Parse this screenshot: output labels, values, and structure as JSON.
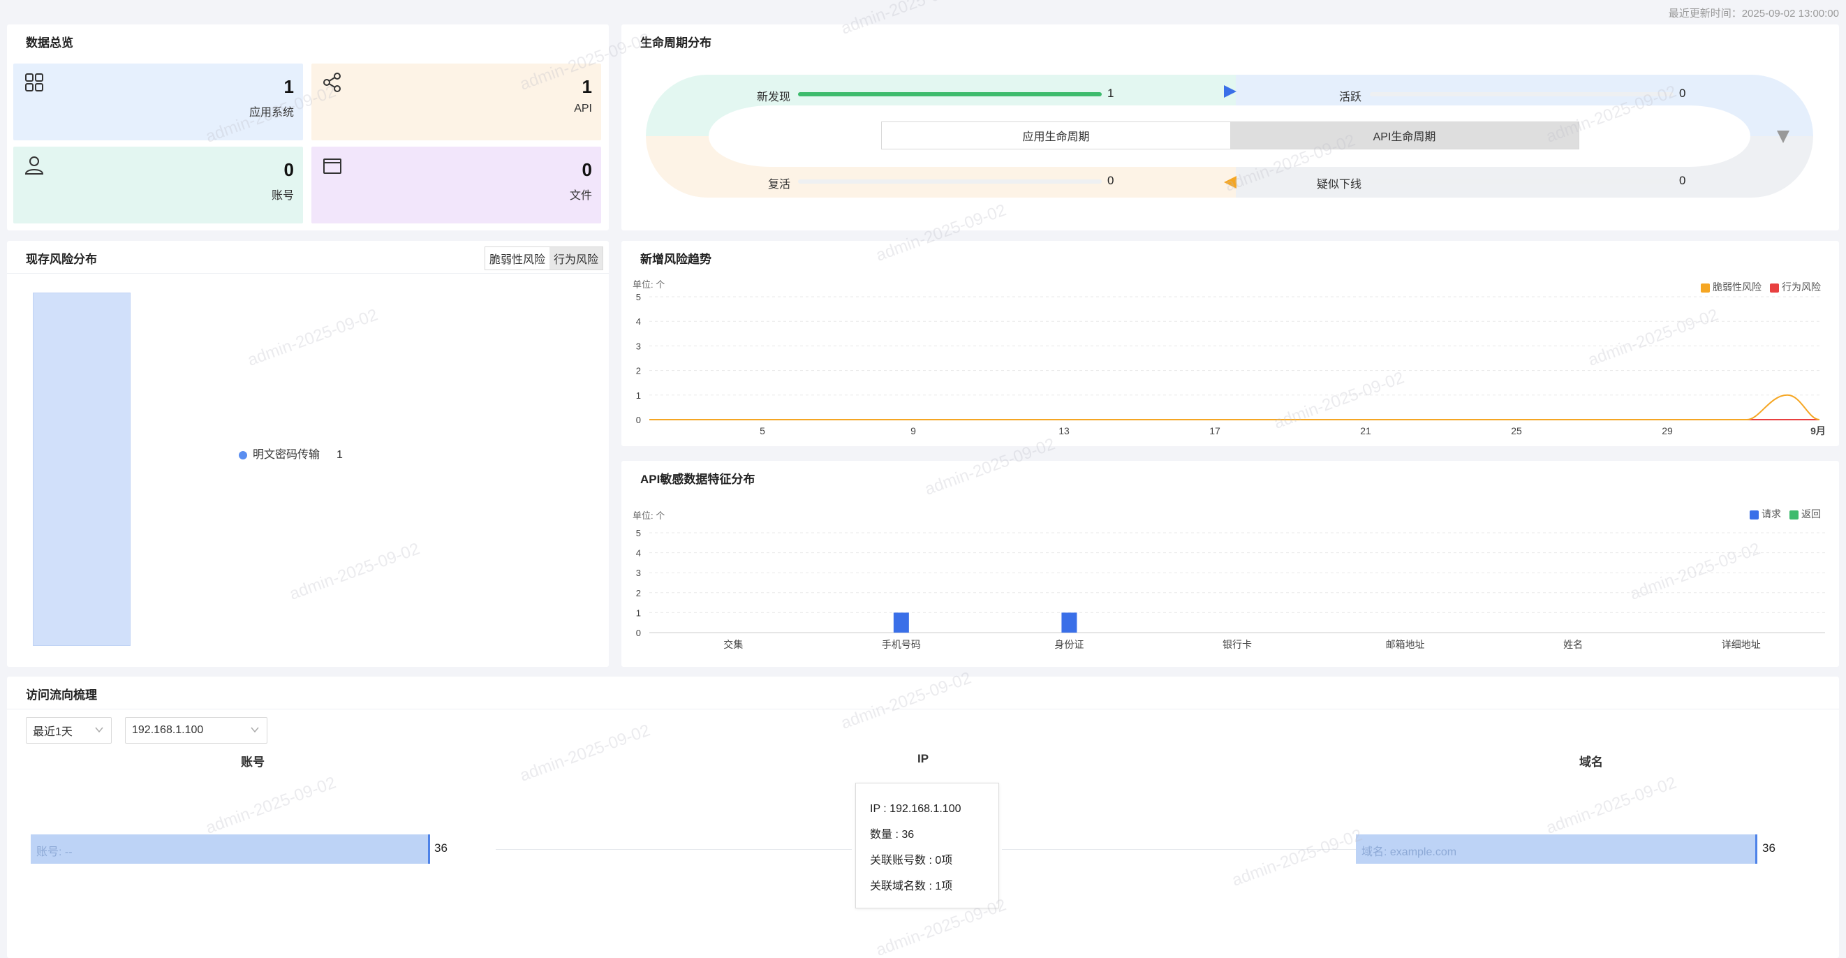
{
  "header": {
    "update_time": "最近更新时间：2025-09-02 13:00:00"
  },
  "overview": {
    "title": "数据总览",
    "cards": [
      {
        "icon": "grid-apps-icon",
        "count": "1",
        "label": "应用系统",
        "color": "#e6f0fd"
      },
      {
        "icon": "share-icon",
        "count": "1",
        "label": "API",
        "color": "#fdf3e6"
      },
      {
        "icon": "user-icon",
        "count": "0",
        "label": "账号",
        "color": "#e3f6f1"
      },
      {
        "icon": "folder-icon",
        "count": "0",
        "label": "文件",
        "color": "#f2e6fb"
      }
    ]
  },
  "lifecycle": {
    "title": "生命周期分布",
    "rows": [
      {
        "label": "新发现",
        "value": "1",
        "fill": 1.0
      },
      {
        "label": "活跃",
        "value": "0",
        "fill": 0
      },
      {
        "label": "复活",
        "value": "0",
        "fill": 0
      },
      {
        "label": "疑似下线",
        "value": "0",
        "fill": 0
      }
    ],
    "toggle": {
      "left": "应用生命周期",
      "right": "API生命周期",
      "active": "right"
    }
  },
  "risk": {
    "title": "现存风险分布",
    "tabs": [
      "脆弱性风险",
      "行为风险"
    ],
    "active_tab": "行为风险",
    "legend": [
      {
        "name": "明文密码传输",
        "value": "1",
        "color": "#5a8ef0"
      }
    ]
  },
  "trend": {
    "title": "新增风险趋势",
    "unit": "单位: 个",
    "legend": [
      {
        "name": "脆弱性风险",
        "color": "#f5a623"
      },
      {
        "name": "行为风险",
        "color": "#e84040"
      }
    ]
  },
  "sensitive": {
    "title": "API敏感数据特征分布",
    "unit": "单位: 个",
    "legend": [
      {
        "name": "请求",
        "color": "#3a6fe8"
      },
      {
        "name": "返回",
        "color": "#3dbb6d"
      }
    ]
  },
  "flow": {
    "title": "访问流向梳理",
    "time_select": "最近1天",
    "ip_select": "192.168.1.100",
    "columns": [
      "账号",
      "IP",
      "域名"
    ],
    "account_bar": {
      "text": "账号: --",
      "count": "36"
    },
    "domain_bar": {
      "text": "域名: example.com",
      "count": "36"
    },
    "tooltip": [
      "IP : 192.168.1.100",
      "数量 : 36",
      "关联账号数 : 0项",
      "关联域名数 : 1项"
    ]
  },
  "watermark": "admin-2025-09-02",
  "chart_data": [
    {
      "type": "line",
      "title": "新增风险趋势",
      "ylabel": "单位: 个",
      "ylim": [
        0,
        5
      ],
      "yticks": [
        0,
        1,
        2,
        3,
        4,
        5
      ],
      "xticks": [
        "5",
        "9",
        "13",
        "17",
        "21",
        "25",
        "29",
        "9月"
      ],
      "series": [
        {
          "name": "脆弱性风险",
          "color": "#f5a623",
          "peak_near_end": 1
        },
        {
          "name": "行为风险",
          "color": "#e84040",
          "values_all": 0
        }
      ]
    },
    {
      "type": "bar",
      "title": "API敏感数据特征分布",
      "ylabel": "单位: 个",
      "ylim": [
        0,
        5
      ],
      "yticks": [
        0,
        1,
        2,
        3,
        4,
        5
      ],
      "categories": [
        "交集",
        "手机号码",
        "身份证",
        "银行卡",
        "邮箱地址",
        "姓名",
        "详细地址"
      ],
      "series": [
        {
          "name": "请求",
          "values": [
            0,
            1,
            1,
            0,
            0,
            0,
            0
          ]
        },
        {
          "name": "返回",
          "values": [
            0,
            0,
            0,
            0,
            0,
            0,
            0
          ]
        }
      ]
    }
  ]
}
